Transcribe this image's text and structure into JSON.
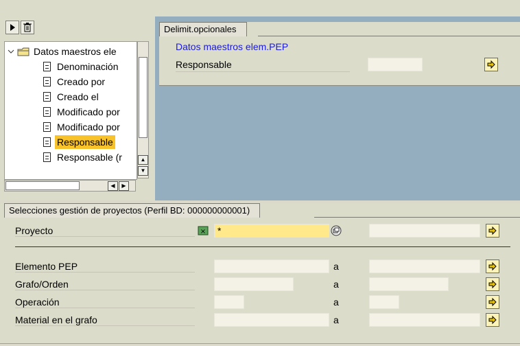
{
  "tree": {
    "root_label": "Datos maestros ele",
    "items": [
      {
        "label": "Denominación"
      },
      {
        "label": "Creado por"
      },
      {
        "label": "Creado el"
      },
      {
        "label": "Modificado por"
      },
      {
        "label": "Modificado por"
      },
      {
        "label": "Responsable",
        "selected": true
      },
      {
        "label": "Responsable (r"
      }
    ]
  },
  "optional": {
    "tab_label": "Delimit.opcionales",
    "group_title": "Datos maestros elem.PEP",
    "field_label": "Responsable"
  },
  "selections": {
    "tab_label": "Selecciones gestión de proyectos (Perfil BD: 000000000001)",
    "project_label": "Proyecto",
    "project_value": "*",
    "range_separator": "a",
    "rows": [
      {
        "label": "Elemento PEP"
      },
      {
        "label": "Grafo/Orden"
      },
      {
        "label": "Operación"
      },
      {
        "label": "Material en el grafo"
      }
    ]
  },
  "colors": {
    "selected_highlight": "#f7c22a",
    "blue_background": "#94aec0",
    "link_text": "#1a1ae0",
    "required_field": "#ffe98a"
  },
  "icons": [
    "play-icon",
    "trash-icon",
    "folder-icon",
    "document-icon",
    "arrow-right-icon",
    "match-code-icon",
    "multiple-selection-icon"
  ]
}
